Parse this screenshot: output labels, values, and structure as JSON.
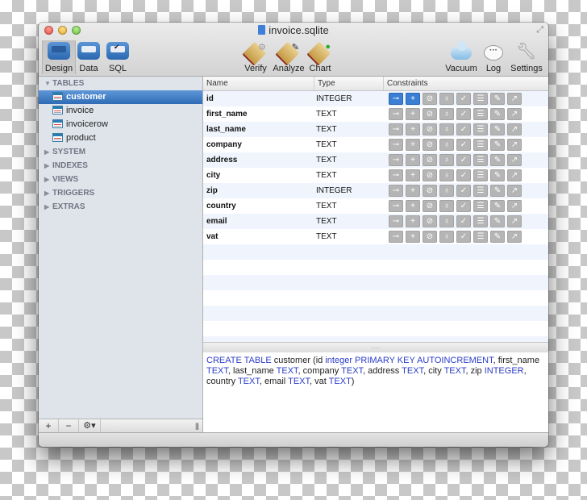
{
  "window": {
    "title": "invoice.sqlite"
  },
  "toolbar": {
    "left": [
      {
        "label": "Design",
        "icon": "design-tray-icon",
        "active": true
      },
      {
        "label": "Data",
        "icon": "data-tray-icon",
        "active": false
      },
      {
        "label": "SQL",
        "icon": "sql-tray-icon",
        "active": false
      }
    ],
    "middle": [
      {
        "label": "Verify",
        "icon": "verify-tag-icon"
      },
      {
        "label": "Analyze",
        "icon": "analyze-tag-icon"
      },
      {
        "label": "Chart",
        "icon": "chart-tag-icon"
      }
    ],
    "right": [
      {
        "label": "Vacuum",
        "icon": "cloud-icon"
      },
      {
        "label": "Log",
        "icon": "speech-bubble-icon"
      },
      {
        "label": "Settings",
        "icon": "wrench-icon"
      }
    ]
  },
  "sidebar": {
    "tables_section": "TABLES",
    "tables": [
      {
        "label": "customer",
        "selected": true
      },
      {
        "label": "invoice",
        "selected": false
      },
      {
        "label": "invoicerow",
        "selected": false
      },
      {
        "label": "product",
        "selected": false
      }
    ],
    "collapsed_sections": [
      "SYSTEM",
      "INDEXES",
      "VIEWS",
      "TRIGGERS",
      "EXTRAS"
    ],
    "bottom": {
      "add": "+",
      "remove": "−",
      "gear": "⚙▾",
      "grip": "|||"
    }
  },
  "grid": {
    "headers": {
      "name": "Name",
      "type": "Type",
      "constraints": "Constraints"
    },
    "constraint_icons": [
      "primary-key-icon",
      "plus-icon",
      "not-null-icon",
      "pin-icon",
      "check-icon",
      "list-icon",
      "wrench-icon",
      "external-link-icon"
    ],
    "constraint_glyphs": [
      "⊸",
      "+",
      "⊘",
      "♁",
      "✓",
      "☰",
      "✎",
      "↗"
    ],
    "rows": [
      {
        "name": "id",
        "type": "INTEGER",
        "active": [
          true,
          true,
          false,
          false,
          false,
          false,
          false,
          false
        ]
      },
      {
        "name": "first_name",
        "type": "TEXT",
        "active": [
          false,
          false,
          false,
          false,
          false,
          false,
          false,
          false
        ]
      },
      {
        "name": "last_name",
        "type": "TEXT",
        "active": [
          false,
          false,
          false,
          false,
          false,
          false,
          false,
          false
        ]
      },
      {
        "name": "company",
        "type": "TEXT",
        "active": [
          false,
          false,
          false,
          false,
          false,
          false,
          false,
          false
        ]
      },
      {
        "name": "address",
        "type": "TEXT",
        "active": [
          false,
          false,
          false,
          false,
          false,
          false,
          false,
          false
        ]
      },
      {
        "name": "city",
        "type": "TEXT",
        "active": [
          false,
          false,
          false,
          false,
          false,
          false,
          false,
          false
        ]
      },
      {
        "name": "zip",
        "type": "INTEGER",
        "active": [
          false,
          false,
          false,
          false,
          false,
          false,
          false,
          false
        ]
      },
      {
        "name": "country",
        "type": "TEXT",
        "active": [
          false,
          false,
          false,
          false,
          false,
          false,
          false,
          false
        ]
      },
      {
        "name": "email",
        "type": "TEXT",
        "active": [
          false,
          false,
          false,
          false,
          false,
          false,
          false,
          false
        ]
      },
      {
        "name": "vat",
        "type": "TEXT",
        "active": [
          false,
          false,
          false,
          false,
          false,
          false,
          false,
          false
        ]
      }
    ]
  },
  "splitter": {
    "grip": "....."
  },
  "sql": {
    "tokens": [
      {
        "t": "CREATE TABLE",
        "kw": true
      },
      {
        "t": " customer (id ",
        "kw": false
      },
      {
        "t": "integer PRIMARY KEY AUTOINCREMENT",
        "kw": true
      },
      {
        "t": ", first_name ",
        "kw": false
      },
      {
        "t": "TEXT",
        "kw": true
      },
      {
        "t": ", last_name ",
        "kw": false
      },
      {
        "t": "TEXT",
        "kw": true
      },
      {
        "t": ", company ",
        "kw": false
      },
      {
        "t": "TEXT",
        "kw": true
      },
      {
        "t": ", address ",
        "kw": false
      },
      {
        "t": "TEXT",
        "kw": true
      },
      {
        "t": ", city ",
        "kw": false
      },
      {
        "t": "TEXT",
        "kw": true
      },
      {
        "t": ", zip ",
        "kw": false
      },
      {
        "t": "INTEGER",
        "kw": true
      },
      {
        "t": ", country ",
        "kw": false
      },
      {
        "t": "TEXT",
        "kw": true
      },
      {
        "t": ", email ",
        "kw": false
      },
      {
        "t": "TEXT",
        "kw": true
      },
      {
        "t": ", vat ",
        "kw": false
      },
      {
        "t": "TEXT",
        "kw": true
      },
      {
        "t": ")",
        "kw": false
      }
    ]
  },
  "colors": {
    "accent": "#3a7fd4",
    "keyword": "#2b3cc8",
    "selection": "#2f6cb5"
  }
}
